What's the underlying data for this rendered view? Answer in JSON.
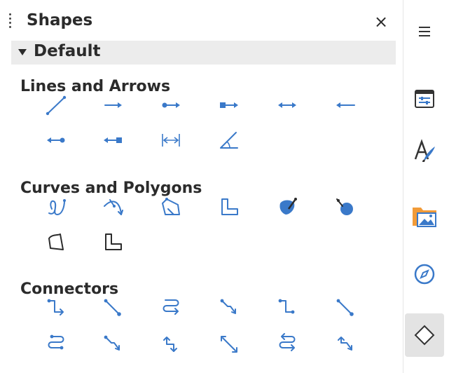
{
  "panel": {
    "title": "Shapes",
    "close_label": "×",
    "section": "Default"
  },
  "categories": [
    {
      "label": "Lines and Arrows",
      "items": [
        "line",
        "line-ends-with-arrow",
        "line-circle-arrow",
        "line-square-arrow",
        "line-with-arrows",
        "line-starts-with-arrow",
        "line-arrow-circle",
        "line-arrow-square",
        "dimension-line",
        "line-45"
      ]
    },
    {
      "label": "Curves and Polygons",
      "items": [
        "curve",
        "polygon",
        "polygon-45",
        "freeform-line",
        "curve-filled",
        "polygon-filled",
        "polygon-45-filled",
        "freeform-line-filled"
      ]
    },
    {
      "label": "Connectors",
      "items": [
        "connector",
        "connector-ends-with-arrow",
        "connector-lines",
        "connector-curved",
        "connector-straight",
        "connector-line-ends-with-arrow",
        "connector-circles",
        "connector-curved-ends-with-arrow",
        "connector-lines-with-arrows",
        "connector-straight-arrows",
        "connector-lines-ends-with-arrow",
        "connector-curved-arrows"
      ]
    }
  ],
  "sidebar": {
    "items": [
      "menu-icon",
      "properties-icon",
      "styles-icon",
      "gallery-icon",
      "navigator-icon",
      "shapes-icon"
    ],
    "active": "shapes-icon"
  },
  "colors": {
    "accent": "#3a79c9",
    "text": "#2b2b2b",
    "header_bg": "#ececec",
    "active_bg": "#e3e3e3",
    "folder": "#f29b38"
  }
}
